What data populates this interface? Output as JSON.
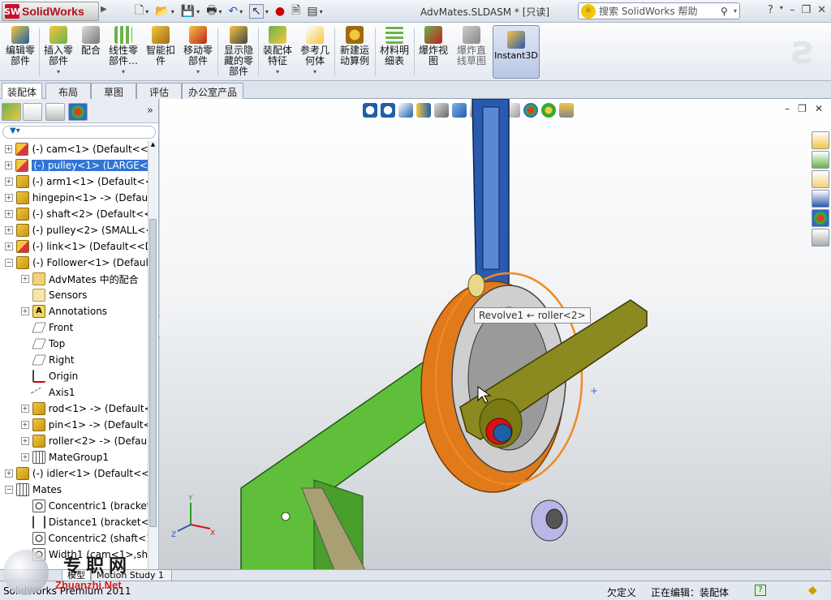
{
  "titlebar": {
    "app_name": "SolidWorks",
    "document_title": "AdvMates.SLDASM * [只读]",
    "search_placeholder": "搜索 SolidWorks 帮助",
    "help": "?",
    "minimize": "–",
    "restore": "❐",
    "close": "✕"
  },
  "ribbon": {
    "buttons": [
      {
        "id": "edit-component",
        "label1": "编辑零",
        "label2": "部件",
        "label3": ""
      },
      {
        "id": "insert-component",
        "label1": "插入零",
        "label2": "部件",
        "label3": "▾"
      },
      {
        "id": "mate",
        "label1": "配合",
        "label2": "",
        "label3": ""
      },
      {
        "id": "linear-pattern",
        "label1": "线性零",
        "label2": "部件…",
        "label3": "▾"
      },
      {
        "id": "smart-fastener",
        "label1": "智能扣",
        "label2": "件",
        "label3": ""
      },
      {
        "id": "move-component",
        "label1": "移动零",
        "label2": "部件",
        "label3": "▾"
      },
      {
        "id": "show-hidden",
        "label1": "显示隐",
        "label2": "藏的零",
        "label3": "部件"
      },
      {
        "id": "assembly-features",
        "label1": "装配体",
        "label2": "特征",
        "label3": "▾"
      },
      {
        "id": "reference-geometry",
        "label1": "参考几",
        "label2": "何体",
        "label3": "▾"
      },
      {
        "id": "new-motion-study",
        "label1": "新建运",
        "label2": "动算例",
        "label3": ""
      },
      {
        "id": "bill-of-materials",
        "label1": "材料明",
        "label2": "细表",
        "label3": ""
      },
      {
        "id": "exploded-view",
        "label1": "爆炸视",
        "label2": "图",
        "label3": ""
      },
      {
        "id": "explode-line-sketch",
        "label1": "爆炸直",
        "label2": "线草图",
        "label3": ""
      }
    ],
    "instant3d": "Instant3D"
  },
  "command_tabs": [
    "装配体",
    "布局",
    "草图",
    "评估",
    "办公室产品"
  ],
  "tree": {
    "items": [
      {
        "label": "(-) cam<1> (Default<<D",
        "icon": "assembly-icon",
        "exp": "+",
        "indent": 0
      },
      {
        "label": "(-) pulley<1> (LARGE<<",
        "icon": "assembly-icon",
        "exp": "+",
        "indent": 0,
        "selected": true
      },
      {
        "label": "(-) arm1<1> (Default<<",
        "icon": "part-icon",
        "exp": "+",
        "indent": 0
      },
      {
        "label": "hingepin<1> -> (Defaul",
        "icon": "part-icon",
        "exp": "+",
        "indent": 0
      },
      {
        "label": "(-) shaft<2> (Default<<",
        "icon": "part-icon",
        "exp": "+",
        "indent": 0
      },
      {
        "label": "(-) pulley<2> (SMALL<<",
        "icon": "part-icon",
        "exp": "+",
        "indent": 0
      },
      {
        "label": "(-) link<1> (Default<<D",
        "icon": "assembly-icon",
        "exp": "+",
        "indent": 0
      },
      {
        "label": "(-) Follower<1> (Defaul",
        "icon": "part-icon",
        "exp": "−",
        "indent": 0
      },
      {
        "label": "AdvMates 中的配合",
        "icon": "folder-icon",
        "exp": "+",
        "indent": 1
      },
      {
        "label": "Sensors",
        "icon": "sensor-icon",
        "exp": "",
        "indent": 1
      },
      {
        "label": "Annotations",
        "icon": "annotation-icon",
        "exp": "+",
        "indent": 1
      },
      {
        "label": "Front",
        "icon": "plane-icon",
        "exp": "",
        "indent": 1
      },
      {
        "label": "Top",
        "icon": "plane-icon",
        "exp": "",
        "indent": 1
      },
      {
        "label": "Right",
        "icon": "plane-icon",
        "exp": "",
        "indent": 1
      },
      {
        "label": "Origin",
        "icon": "origin-icon",
        "exp": "",
        "indent": 1
      },
      {
        "label": "Axis1",
        "icon": "axis-icon",
        "exp": "",
        "indent": 1
      },
      {
        "label": "rod<1> -> (Default<",
        "icon": "part-icon",
        "exp": "+",
        "indent": 1
      },
      {
        "label": "pin<1> -> (Default<",
        "icon": "part-icon",
        "exp": "+",
        "indent": 1
      },
      {
        "label": "roller<2> -> (Defaul",
        "icon": "part-icon",
        "exp": "+",
        "indent": 1
      },
      {
        "label": "MateGroup1",
        "icon": "mategroup-icon",
        "exp": "+",
        "indent": 1
      },
      {
        "label": "(-) idler<1> (Default<<",
        "icon": "part-icon",
        "exp": "+",
        "indent": 0
      },
      {
        "label": "Mates",
        "icon": "mategroup-icon",
        "exp": "−",
        "indent": 0
      },
      {
        "label": "Concentric1 (bracket",
        "icon": "mate-icon",
        "exp": "",
        "indent": 1
      },
      {
        "label": "Distance1 (bracket<",
        "icon": "distance-icon",
        "exp": "",
        "indent": 1
      },
      {
        "label": "Concentric2 (shaft<1",
        "icon": "mate-icon",
        "exp": "",
        "indent": 1
      },
      {
        "label": "Width1 (cam<1>,sh",
        "icon": "mate-icon",
        "exp": "",
        "indent": 1
      }
    ]
  },
  "viewport": {
    "tooltip": "Revolve1 ← roller<2>",
    "triad": {
      "x": "X",
      "y": "Y",
      "z": "Z"
    }
  },
  "model_tabs": [
    "模型",
    "Motion Study 1"
  ],
  "status": {
    "product": "SolidWorks Premium 2011",
    "underdefined": "欠定义",
    "editing": "正在编辑：装配体",
    "help_icon": "?"
  },
  "watermark": {
    "cn": "专职网",
    "url": "Zhuanzhi.Net"
  },
  "colors": {
    "selection": "#3274d6",
    "bracket_green": "#5fbf3a",
    "pulley_orange": "#e07a1a",
    "arm_olive": "#8a8a20",
    "rod_blue": "#2a5ab0"
  }
}
